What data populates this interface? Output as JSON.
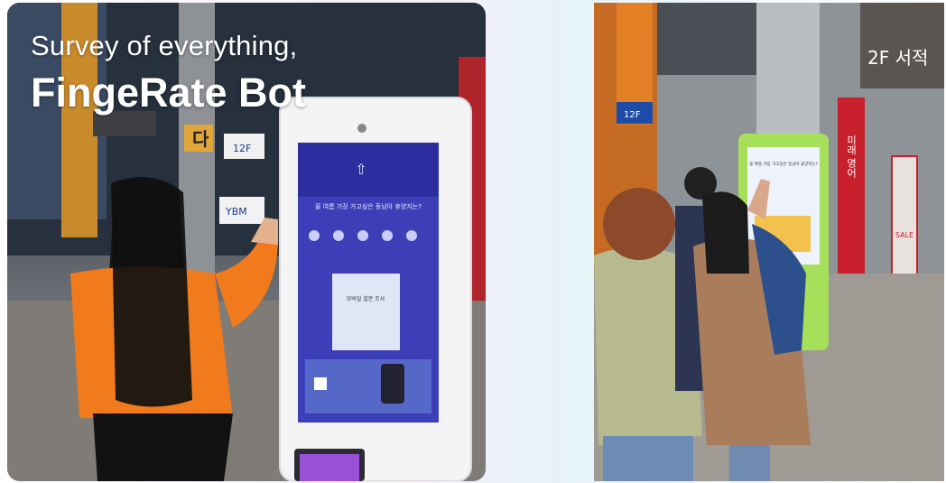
{
  "left_photo": {
    "title_line1": "Survey of everything,",
    "title_line2": "FingeRate Bot",
    "kiosk_question": "올 여름 가장 가고싶은 동남아 휴양지는?",
    "kiosk_card_title": "모바일 설문 조사",
    "store_sign": "YBM",
    "floor_sign": "12F",
    "shop_sign": "다"
  },
  "right_photo": {
    "store_sign": "2F 서적",
    "banner_vertical": "미래 영어",
    "floor_badge": "2F",
    "sale_banner": "SALE",
    "floor_sign": "12F",
    "kiosk_question": "올 여름 가장 가고싶은 동남아 휴양지는?"
  },
  "colors": {
    "kiosk_screen": "#3d3fb8",
    "kiosk_frame_right": "#a6e05b",
    "sweater": "#f07a1c",
    "banner_red": "#c8202c"
  }
}
